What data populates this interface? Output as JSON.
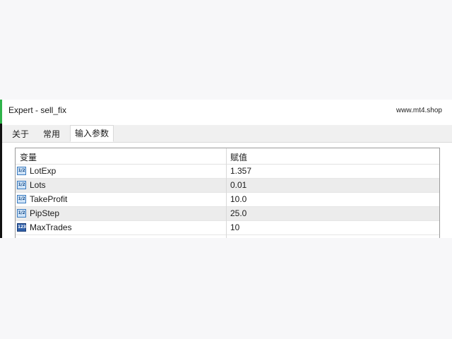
{
  "window": {
    "title": "Expert - sell_fix",
    "watermark": "www.mt4.shop"
  },
  "tabs": [
    {
      "label": "关于",
      "active": false
    },
    {
      "label": "常用",
      "active": false
    },
    {
      "label": "输入参数",
      "active": true
    }
  ],
  "table": {
    "headers": {
      "variable": "变量",
      "value": "赋值"
    },
    "rows": [
      {
        "name": "LotExp",
        "value": "1.357",
        "icon": "double-type-icon",
        "icon_text": "1/2"
      },
      {
        "name": "Lots",
        "value": "0.01",
        "icon": "double-type-icon",
        "icon_text": "1/2"
      },
      {
        "name": "TakeProfit",
        "value": "10.0",
        "icon": "double-type-icon",
        "icon_text": "1/2"
      },
      {
        "name": "PipStep",
        "value": "25.0",
        "icon": "double-type-icon",
        "icon_text": "1/2"
      },
      {
        "name": "MaxTrades",
        "value": "10",
        "icon": "integer-type-icon",
        "icon_text": "123"
      }
    ]
  },
  "colors": {
    "accent_green": "#2fb34a",
    "alt_row": "#ececec",
    "grid_border": "#9a9a9a"
  }
}
